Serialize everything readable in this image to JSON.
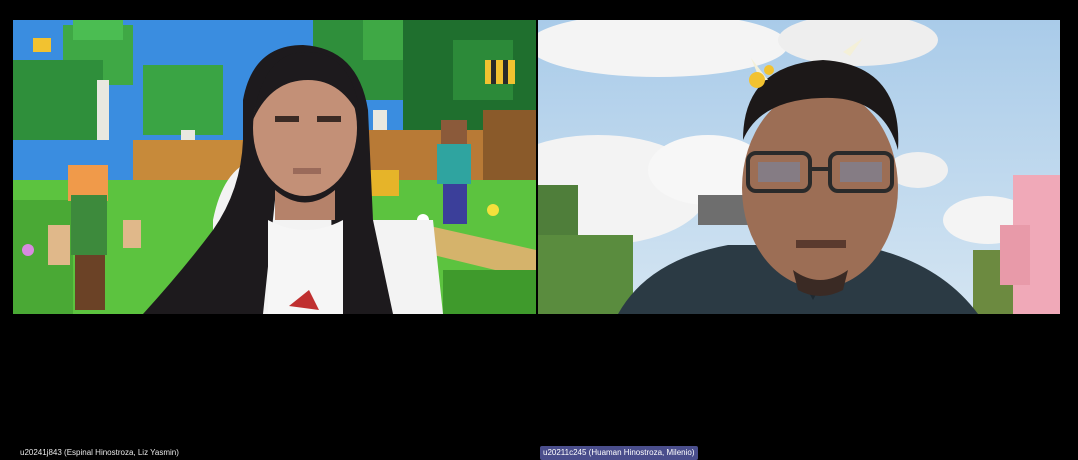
{
  "meeting": {
    "participants": [
      {
        "name": "u20241j843 (Espinal Hinostroza, Liz Yasmin)",
        "background": "minecraft-village",
        "active_speaker": false
      },
      {
        "name": "u20211c245 (Huaman Hinostroza, Milenio)",
        "background": "minecraft-sky",
        "active_speaker": true
      }
    ]
  },
  "colors": {
    "stage_bg": "#000000",
    "active_label_bg": "#4a4e8c",
    "label_text": "#e8e8e8"
  }
}
